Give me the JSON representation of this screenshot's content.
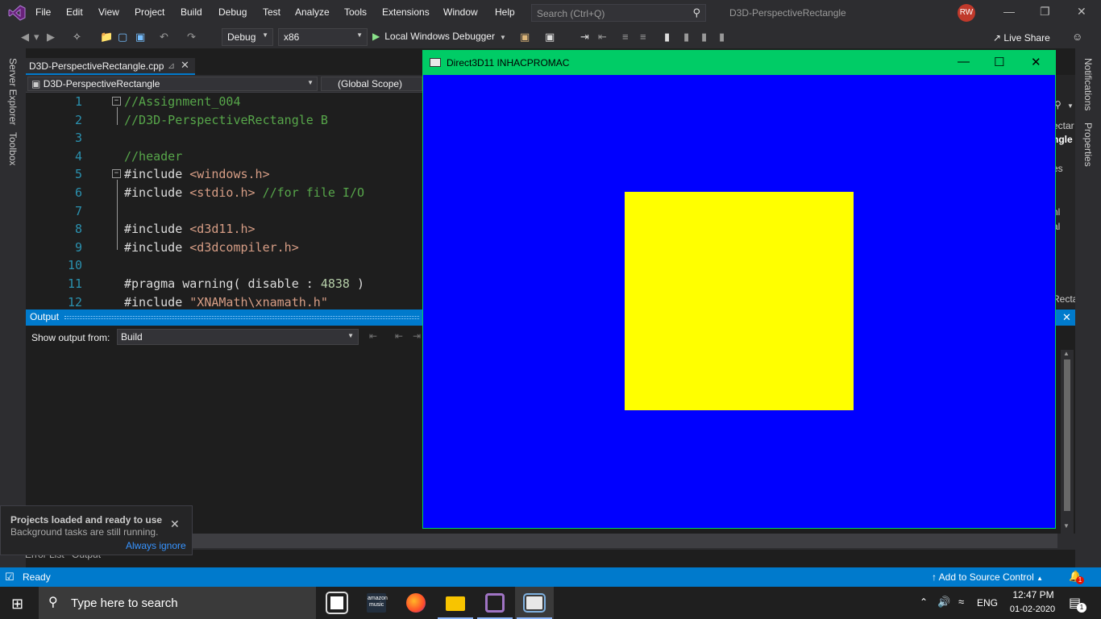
{
  "menu": [
    "File",
    "Edit",
    "View",
    "Project",
    "Build",
    "Debug",
    "Test",
    "Analyze",
    "Tools",
    "Extensions",
    "Window",
    "Help"
  ],
  "search": {
    "placeholder": "Search (Ctrl+Q)"
  },
  "solution_name": "D3D-PerspectiveRectangle",
  "user_initials": "RW",
  "toolbar": {
    "config": "Debug",
    "platform": "x86",
    "run_label": "Local Windows Debugger",
    "live_share": "Live Share"
  },
  "left_tabs": [
    "Server Explorer",
    "Toolbox"
  ],
  "right_tabs": [
    "Notifications",
    "Properties"
  ],
  "editor": {
    "tab_name": "D3D-PerspectiveRectangle.cpp",
    "project": "D3D-PerspectiveRectangle",
    "scope": "(Global Scope)",
    "lines": [
      {
        "n": "1",
        "parts": [
          {
            "t": "//Assignment_004",
            "c": "cmt"
          }
        ]
      },
      {
        "n": "2",
        "parts": [
          {
            "t": "//D3D-PerspectiveRectangle B",
            "c": "cmt"
          }
        ]
      },
      {
        "n": "3",
        "parts": []
      },
      {
        "n": "4",
        "parts": [
          {
            "t": "//header",
            "c": "cmt"
          }
        ]
      },
      {
        "n": "5",
        "parts": [
          {
            "t": "#include ",
            "c": ""
          },
          {
            "t": "<windows.h>",
            "c": "str"
          }
        ]
      },
      {
        "n": "6",
        "parts": [
          {
            "t": "#include ",
            "c": ""
          },
          {
            "t": "<stdio.h>",
            "c": "str"
          },
          {
            "t": " //for file I/O",
            "c": "cmt"
          }
        ]
      },
      {
        "n": "7",
        "parts": []
      },
      {
        "n": "8",
        "parts": [
          {
            "t": "#include ",
            "c": ""
          },
          {
            "t": "<d3d11.h>",
            "c": "str"
          }
        ]
      },
      {
        "n": "9",
        "parts": [
          {
            "t": "#include ",
            "c": ""
          },
          {
            "t": "<d3dcompiler.h>",
            "c": "str"
          }
        ]
      },
      {
        "n": "10",
        "parts": []
      },
      {
        "n": "11",
        "parts": [
          {
            "t": "#pragma warning( disable : ",
            "c": ""
          },
          {
            "t": "4838",
            "c": "num"
          },
          {
            "t": " )",
            "c": ""
          }
        ]
      },
      {
        "n": "12",
        "parts": [
          {
            "t": "#include ",
            "c": ""
          },
          {
            "t": "\"XNAMath\\xnamath.h\"",
            "c": "str"
          }
        ]
      }
    ]
  },
  "right_panel_fragments": [
    "ectar",
    "ngle",
    "es",
    "nl",
    "al",
    "l",
    "Recta"
  ],
  "output": {
    "title": "Output",
    "show_from_label": "Show output from:",
    "source": "Build"
  },
  "bottom_tabs": [
    "Error List",
    "Output"
  ],
  "toast": {
    "title": "Projects loaded and ready to use",
    "body": "Background tasks are still running.",
    "link": "Always ignore"
  },
  "status": {
    "ready": "Ready",
    "source_control": "Add to Source Control",
    "bell_count": "1"
  },
  "d3d_window": {
    "title": "Direct3D11 INHACPROMAC",
    "background": "#0000ff",
    "rect_color": "#ffff00",
    "title_color": "#00cc66"
  },
  "taskbar": {
    "search_placeholder": "Type here to search",
    "lang": "ENG",
    "time": "12:47 PM",
    "date": "01-02-2020",
    "amazon_line1": "amazon",
    "amazon_line2": "music",
    "notif_count": "1"
  }
}
